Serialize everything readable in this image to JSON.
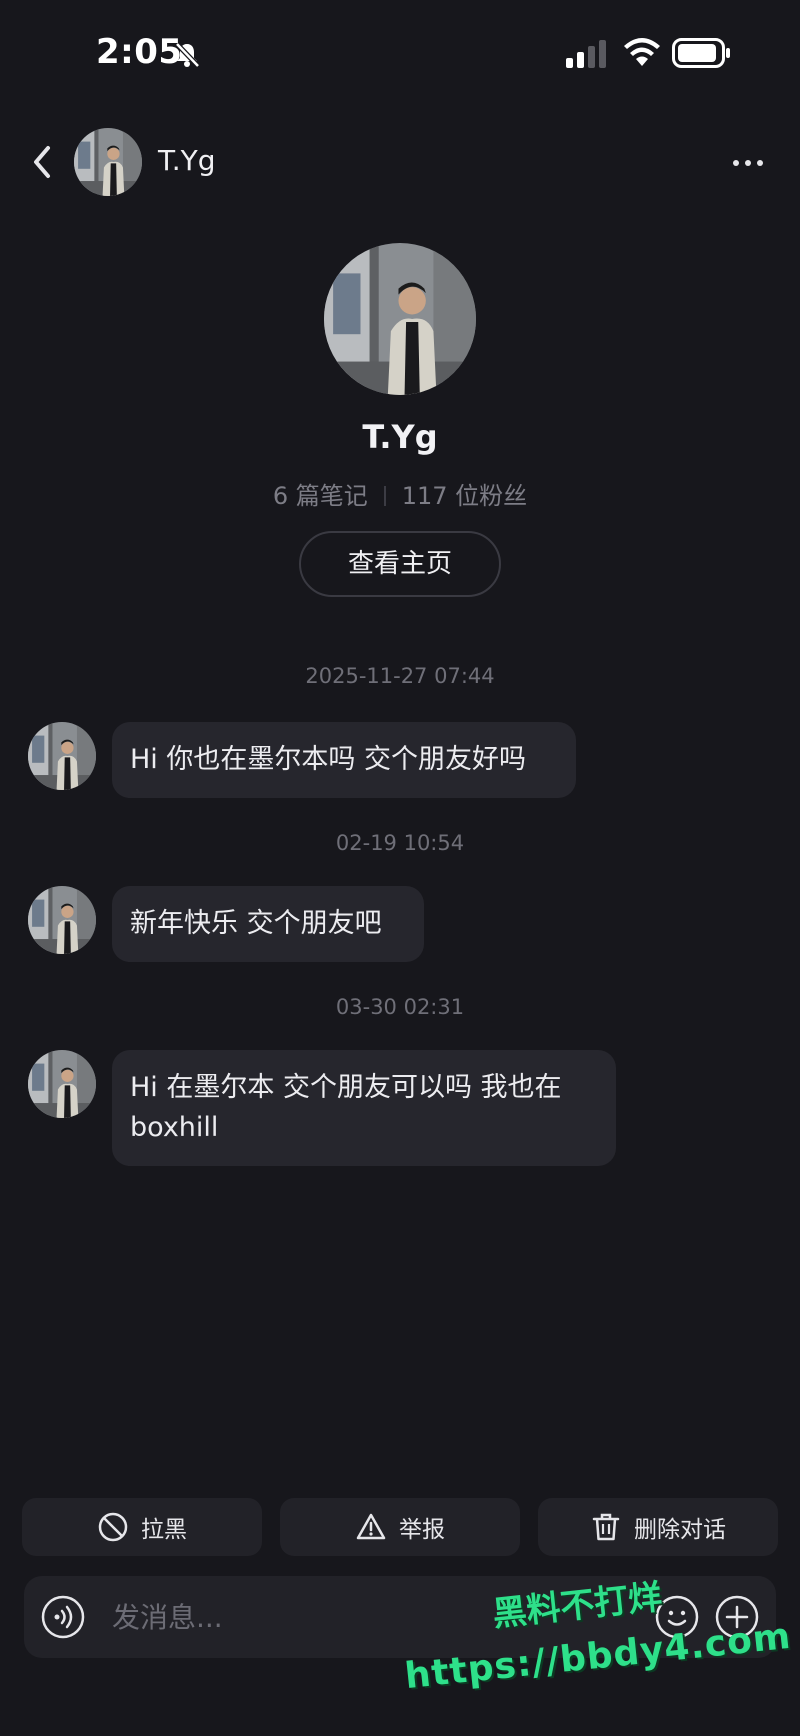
{
  "status_bar": {
    "time": "2:05"
  },
  "header": {
    "name": "T.Yg"
  },
  "profile": {
    "name": "T.Yg",
    "notes": "6 篇笔记",
    "followers": "117 位粉丝",
    "view_home_label": "查看主页"
  },
  "messages": [
    {
      "timestamp": "2025-11-27 07:44",
      "text": "Hi 你也在墨尔本吗 交个朋友好吗"
    },
    {
      "timestamp": "02-19 10:54",
      "text": "新年快乐 交个朋友吧"
    },
    {
      "timestamp": "03-30 02:31",
      "text": "Hi 在墨尔本 交个朋友可以吗 我也在 boxhill"
    }
  ],
  "actions": {
    "block_label": "拉黑",
    "report_label": "举报",
    "delete_label": "删除对话"
  },
  "input": {
    "placeholder": "发消息..."
  },
  "watermark": {
    "line1": "黑料不打烊",
    "line2": "https://bbdy4.com"
  },
  "colors": {
    "background": "#17171c",
    "bubble": "#26262d",
    "watermark": "#2ee08a"
  },
  "icons": [
    "bell-slash-icon",
    "signal-icon",
    "wifi-icon",
    "battery-icon",
    "back-arrow-icon",
    "more-dots-icon",
    "block-icon",
    "warning-icon",
    "trash-icon",
    "voice-icon",
    "emoji-icon",
    "plus-icon"
  ]
}
